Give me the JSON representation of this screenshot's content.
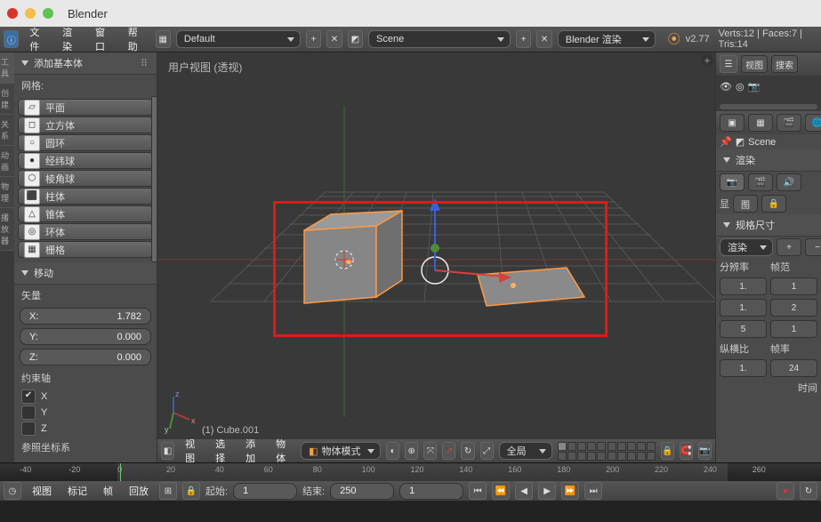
{
  "app_title": "Blender",
  "topbar": {
    "menus": [
      "文件",
      "渲染",
      "窗口",
      "帮助"
    ],
    "layout_dropdown": "Default",
    "scene_dropdown": "Scene",
    "render_engine": "Blender 渲染",
    "version": "v2.77",
    "stats": "Verts:12 | Faces:7 | Tris:14"
  },
  "toolshelf": {
    "panel1_title": "添加基本体",
    "meshes_label": "网格:",
    "mesh_items": [
      "平面",
      "立方体",
      "圆环",
      "经纬球",
      "棱角球",
      "柱体",
      "锥体",
      "环体",
      "栅格"
    ],
    "panel2_title": "移动",
    "vector_label": "矢量",
    "x_label": "X:",
    "x_value": "1.782",
    "y_label": "Y:",
    "y_value": "0.000",
    "z_label": "Z:",
    "z_value": "0.000",
    "constraint_label": "约束轴",
    "cx": "X",
    "cy": "Y",
    "cz": "Z",
    "ref_label": "参照坐标系"
  },
  "vertical_tabs": [
    "工具",
    "创建",
    "关系",
    "动画",
    "物理",
    "播放器"
  ],
  "viewport": {
    "view_label": "用户视图 (透视)",
    "object_label": "(1) Cube.001",
    "header_menus": [
      "视图",
      "选择",
      "添加",
      "物体"
    ],
    "mode": "物体模式",
    "orientation": "全局"
  },
  "properties": {
    "scene_name": "Scene",
    "render_panel": "渲染",
    "dimensions_panel": "规格尺寸",
    "display_label": "显",
    "preset": "渲染",
    "res_label": "分辨率",
    "frame_label": "帧范",
    "res_x": "1.",
    "res_y": "1.",
    "res_pct": "5",
    "fr_start": "1",
    "fr_end": "2",
    "fr_step": "1",
    "aspect_label": "纵横比",
    "rate_label": "帧率",
    "aspect_x": "1.",
    "fps": "24",
    "time_label": "时间",
    "view_btn": "视图",
    "search_btn": "搜索"
  },
  "timeline": {
    "ticks": [
      "-40",
      "-20",
      "0",
      "20",
      "40",
      "60",
      "80",
      "100",
      "120",
      "140",
      "160",
      "180",
      "200",
      "220",
      "240",
      "260"
    ],
    "menus": [
      "视图",
      "标记",
      "帧",
      "回放"
    ],
    "start_label": "起始:",
    "start_value": "1",
    "end_label": "结束:",
    "end_value": "250",
    "current_frame": "1"
  },
  "colors": {
    "red": "#d7352b",
    "yellow": "#f3be4b",
    "green": "#60c253",
    "orange_sel": "#ff9944",
    "axis_x": "#a83c3c",
    "axis_y": "#4d8b3a",
    "axis_z": "#3c5fa8"
  },
  "chart_data": null
}
